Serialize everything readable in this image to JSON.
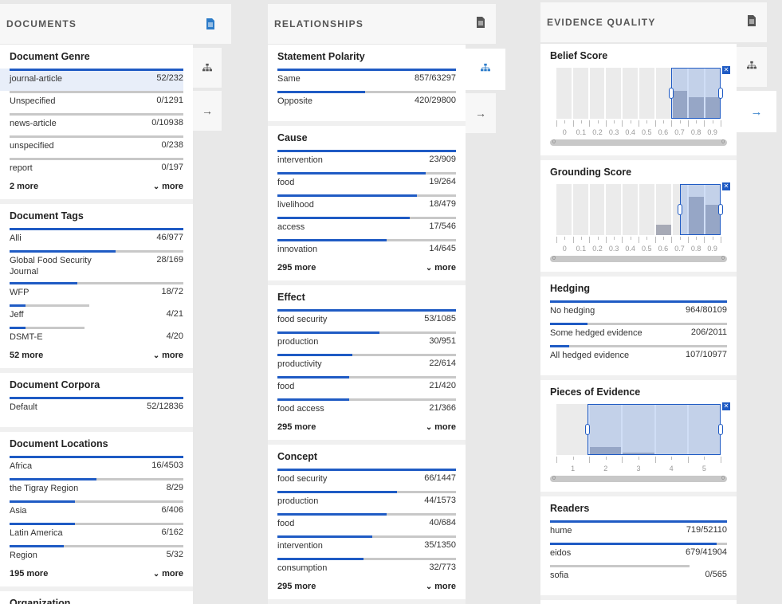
{
  "colors": {
    "accent": "#1f5bc4",
    "tab_active": "#2b7bc9",
    "track": "#c8c8c8"
  },
  "documents_panel": {
    "title": "DOCUMENTS",
    "tabs": [
      "document-icon",
      "network-icon",
      "arrow-right-icon"
    ],
    "sections": [
      {
        "title": "Document Genre",
        "rows": [
          {
            "label": "journal-article",
            "count": "52/232",
            "fill": 1.0,
            "selected": true
          },
          {
            "label": "Unspecified",
            "count": "0/1291",
            "fill": 0
          },
          {
            "label": "news-article",
            "count": "0/10938",
            "fill": 0
          },
          {
            "label": "unspecified",
            "count": "0/238",
            "fill": 0
          },
          {
            "label": "report",
            "count": "0/197",
            "fill": 0
          }
        ],
        "more_count": "2 more",
        "more_label": "more"
      },
      {
        "title": "Document Tags",
        "rows": [
          {
            "label": "Alli",
            "count": "46/977",
            "fill": 1.0
          },
          {
            "label": "Global Food Security Journal",
            "count": "28/169",
            "fill": 0.61,
            "tall": true
          },
          {
            "label": "WFP",
            "count": "18/72",
            "fill": 0.39
          },
          {
            "label": "Jeff",
            "count": "4/21",
            "fill": 0.09,
            "track": 0.46
          },
          {
            "label": "DSMT-E",
            "count": "4/20",
            "fill": 0.09,
            "track": 0.43
          }
        ],
        "more_count": "52 more",
        "more_label": "more"
      },
      {
        "title": "Document Corpora",
        "rows": [
          {
            "label": "Default",
            "count": "52/12836",
            "fill": 1.0
          }
        ]
      },
      {
        "title": "Document Locations",
        "rows": [
          {
            "label": "Africa",
            "count": "16/4503",
            "fill": 1.0
          },
          {
            "label": "the Tigray Region",
            "count": "8/29",
            "fill": 0.5
          },
          {
            "label": "Asia",
            "count": "6/406",
            "fill": 0.375
          },
          {
            "label": "Latin America",
            "count": "6/162",
            "fill": 0.375
          },
          {
            "label": "Region",
            "count": "5/32",
            "fill": 0.31
          }
        ],
        "more_count": "195 more",
        "more_label": "more"
      },
      {
        "title": "Organization",
        "rows": []
      }
    ]
  },
  "relationships_panel": {
    "title": "RELATIONSHIPS",
    "sections": [
      {
        "title": "Statement Polarity",
        "rows": [
          {
            "label": "Same",
            "count": "857/63297",
            "fill": 1.0
          },
          {
            "label": "Opposite",
            "count": "420/29800",
            "fill": 0.49
          }
        ]
      },
      {
        "title": "Cause",
        "rows": [
          {
            "label": "intervention",
            "count": "23/909",
            "fill": 1.0
          },
          {
            "label": "food",
            "count": "19/264",
            "fill": 0.83
          },
          {
            "label": "livelihood",
            "count": "18/479",
            "fill": 0.78
          },
          {
            "label": "access",
            "count": "17/546",
            "fill": 0.74
          },
          {
            "label": "innovation",
            "count": "14/645",
            "fill": 0.61
          }
        ],
        "more_count": "295 more",
        "more_label": "more"
      },
      {
        "title": "Effect",
        "rows": [
          {
            "label": "food security",
            "count": "53/1085",
            "fill": 1.0
          },
          {
            "label": "production",
            "count": "30/951",
            "fill": 0.57
          },
          {
            "label": "productivity",
            "count": "22/614",
            "fill": 0.42
          },
          {
            "label": "food",
            "count": "21/420",
            "fill": 0.4
          },
          {
            "label": "food access",
            "count": "21/366",
            "fill": 0.4
          }
        ],
        "more_count": "295 more",
        "more_label": "more"
      },
      {
        "title": "Concept",
        "rows": [
          {
            "label": "food security",
            "count": "66/1447",
            "fill": 1.0
          },
          {
            "label": "production",
            "count": "44/1573",
            "fill": 0.67
          },
          {
            "label": "food",
            "count": "40/684",
            "fill": 0.61
          },
          {
            "label": "intervention",
            "count": "35/1350",
            "fill": 0.53
          },
          {
            "label": "consumption",
            "count": "32/773",
            "fill": 0.48
          }
        ],
        "more_count": "295 more",
        "more_label": "more"
      }
    ]
  },
  "evidence_panel": {
    "title": "EVIDENCE QUALITY",
    "belief": {
      "title": "Belief Score",
      "ticks": [
        "0",
        "0.1",
        "0.2",
        "0.3",
        "0.4",
        "0.5",
        "0.6",
        "0.7",
        "0.8",
        "0.9"
      ],
      "bins": [
        0,
        0,
        0,
        0,
        0,
        0,
        0,
        0.55,
        0.42,
        0.42
      ],
      "sel_from": 0.7,
      "sel_to": 1.0,
      "scroll_left": "0",
      "scroll_right": "0"
    },
    "grounding": {
      "title": "Grounding Score",
      "ticks": [
        "0",
        "0.1",
        "0.2",
        "0.3",
        "0.4",
        "0.5",
        "0.6",
        "0.7",
        "0.8",
        "0.9"
      ],
      "bins": [
        0,
        0,
        0,
        0,
        0,
        0,
        0.2,
        0,
        0.75,
        0.6
      ],
      "sel_from": 0.75,
      "sel_to": 1.0,
      "scroll_left": "0",
      "scroll_right": "0"
    },
    "hedging": {
      "title": "Hedging",
      "rows": [
        {
          "label": "No hedging",
          "count": "964/80109",
          "fill": 1.0
        },
        {
          "label": "Some hedged evidence",
          "count": "206/2011",
          "fill": 0.21
        },
        {
          "label": "All hedged evidence",
          "count": "107/10977",
          "fill": 0.11
        }
      ]
    },
    "pieces": {
      "title": "Pieces of Evidence",
      "ticks": [
        "1",
        "2",
        "3",
        "4",
        "5"
      ],
      "bins": [
        0,
        0.15,
        0.05,
        0,
        0
      ],
      "sel_from": 0.19,
      "sel_to": 1.0,
      "scroll_left": "0",
      "scroll_right": "0"
    },
    "readers": {
      "title": "Readers",
      "rows": [
        {
          "label": "hume",
          "count": "719/52110",
          "fill": 1.0
        },
        {
          "label": "eidos",
          "count": "679/41904",
          "fill": 0.94
        },
        {
          "label": "sofia",
          "count": "0/565",
          "fill": 0,
          "track": 0.79
        }
      ]
    }
  }
}
